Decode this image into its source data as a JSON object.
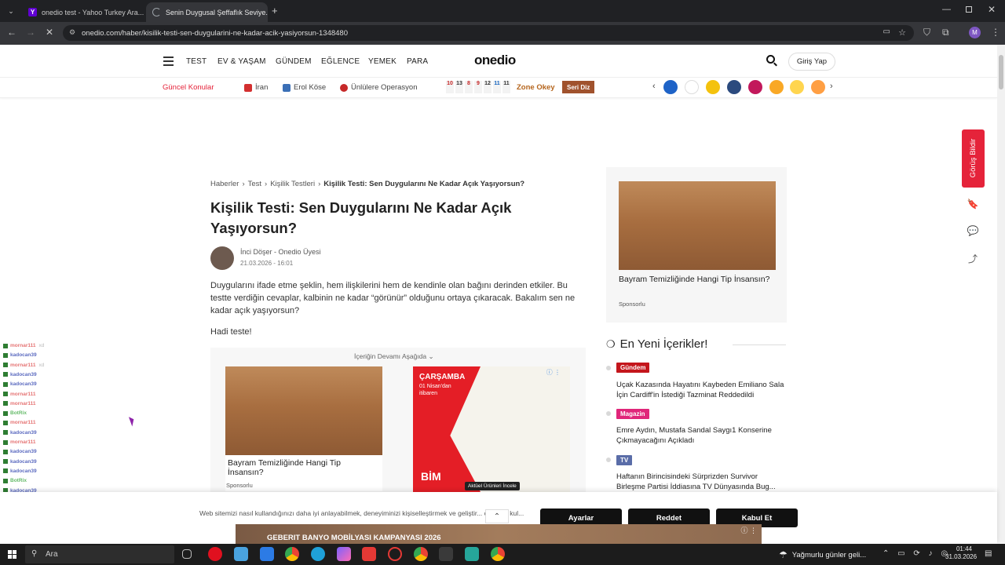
{
  "browser": {
    "tabs": [
      {
        "title": "onedio test - Yahoo Turkey Ara..."
      },
      {
        "title": "Senin Duygusal Şeffaflık Seviye..."
      }
    ],
    "url": "onedio.com/haber/kisilik-testi-sen-duygularini-ne-kadar-acik-yasiyorsun-1348480",
    "profile_letter": "M"
  },
  "nav": {
    "items": [
      "TEST",
      "EV & YAŞAM",
      "GÜNDEM",
      "EĞLENCE",
      "YEMEK",
      "PARA"
    ],
    "logo": "onedio",
    "login": "Giriş Yap"
  },
  "trending": {
    "label": "Güncel Konular",
    "items": [
      "İran",
      "Erol Köse",
      "Ünlülere Operasyon"
    ],
    "game_numbers": [
      "10",
      "13",
      "8",
      "9",
      "12",
      "11",
      "11"
    ],
    "zone": "Zone Okey",
    "seri": "Seri Diz"
  },
  "breadcrumb": {
    "items": [
      "Haberler",
      "Test",
      "Kişilik Testleri"
    ],
    "current": "Kişilik Testi: Sen Duygularını Ne Kadar Açık Yaşıyorsun?"
  },
  "article": {
    "title": "Kişilik Testi: Sen Duygularını Ne Kadar Açık Yaşıyorsun?",
    "author": "İnci Döşer",
    "author_role": "Onedio Üyesi",
    "date": "21.03.2026 - 16:01",
    "intro": "Duygularını ifade etme şeklin, hem ilişkilerini hem de kendinle olan bağını derinden etkiler. Bu testte verdiğin cevaplar, kalbinin ne kadar “görünür” olduğunu ortaya çıkaracak. Bakalım sen ne kadar açık yaşıyorsun?",
    "hadi": "Hadi teste!",
    "continue": "İçeriğin Devamı Aşağıda"
  },
  "ads": {
    "inline_title": "Bayram Temizliğinde Hangi Tip İnsansın?",
    "sponsor": "Sponsorlu",
    "bim_day": "ÇARŞAMBA",
    "bim_date": "01 Nisan'dan itibaren",
    "bim_logo": "BİM",
    "bim_cta": "Aktüel Ürünleri İncele",
    "side_title": "Bayram Temizliğinde Hangi Tip İnsansın?",
    "banner_text": "GEBERIT BANYO MOBİLYASI KAMPANYASI 2026"
  },
  "sidebar": {
    "heading": "En Yeni İçerikler!",
    "news": [
      {
        "category": "Gündem",
        "color": "#c4161c",
        "title": "Uçak Kazasında Hayatını Kaybeden Emiliano Sala İçin Cardiff'in İstediği Tazminat Reddedildi"
      },
      {
        "category": "Magazin",
        "color": "#e0267a",
        "title": "Emre Aydın, Mustafa Sandal Saygı1 Konserine Çıkmayacağını Açıkladı"
      },
      {
        "category": "TV",
        "color": "#5a6da8",
        "title": "Haftanın Birincisindeki Sürprizden Survivor Birleşme Partisi İddiasına TV Dünyasında Bug..."
      }
    ]
  },
  "feedback": "Görüş Bildir",
  "chat": [
    {
      "user": "mornar111",
      "color": "#e57373",
      "msg": "xd"
    },
    {
      "user": "kadocan39",
      "color": "#5c6bc0",
      "msg": ""
    },
    {
      "user": "mornar111",
      "color": "#e57373",
      "msg": "xd"
    },
    {
      "user": "kadocan39",
      "color": "#5c6bc0",
      "msg": ""
    },
    {
      "user": "kadocan39",
      "color": "#5c6bc0",
      "msg": ""
    },
    {
      "user": "mornar111",
      "color": "#e57373",
      "msg": ""
    },
    {
      "user": "mornar111",
      "color": "#e57373",
      "msg": ""
    },
    {
      "user": "BotRix",
      "color": "#66bb6a",
      "msg": ""
    },
    {
      "user": "mornar111",
      "color": "#e57373",
      "msg": ""
    },
    {
      "user": "kadocan39",
      "color": "#5c6bc0",
      "msg": ""
    },
    {
      "user": "mornar111",
      "color": "#e57373",
      "msg": ""
    },
    {
      "user": "kadocan39",
      "color": "#5c6bc0",
      "msg": ""
    },
    {
      "user": "kadocan39",
      "color": "#5c6bc0",
      "msg": ""
    },
    {
      "user": "kadocan39",
      "color": "#5c6bc0",
      "msg": ""
    },
    {
      "user": "BotRix",
      "color": "#66bb6a",
      "msg": ""
    },
    {
      "user": "kadocan39",
      "color": "#5c6bc0",
      "msg": ""
    },
    {
      "user": "kadocan39",
      "color": "#5c6bc0",
      "msg": ""
    },
    {
      "user": "kadocan39",
      "color": "#5c6bc0",
      "msg": ""
    },
    {
      "user": "BotRix",
      "color": "#66bb6a",
      "msg": ""
    },
    {
      "user": "kadocan39",
      "color": "#5c6bc0",
      "msg": ""
    }
  ],
  "cookie": {
    "text": "Web sitemizi nasıl kullandığınızı daha iyi anlayabilmek, deneyiminizi kişiselleştirmek ve geliştir... çerezler kul...",
    "settings": "Ayarlar",
    "reject": "Reddet",
    "accept": "Kabul Et"
  },
  "taskbar": {
    "search": "Ara",
    "weather": "Yağmurlu günler geli...",
    "time": "01:44",
    "date": "31.03.2026"
  }
}
